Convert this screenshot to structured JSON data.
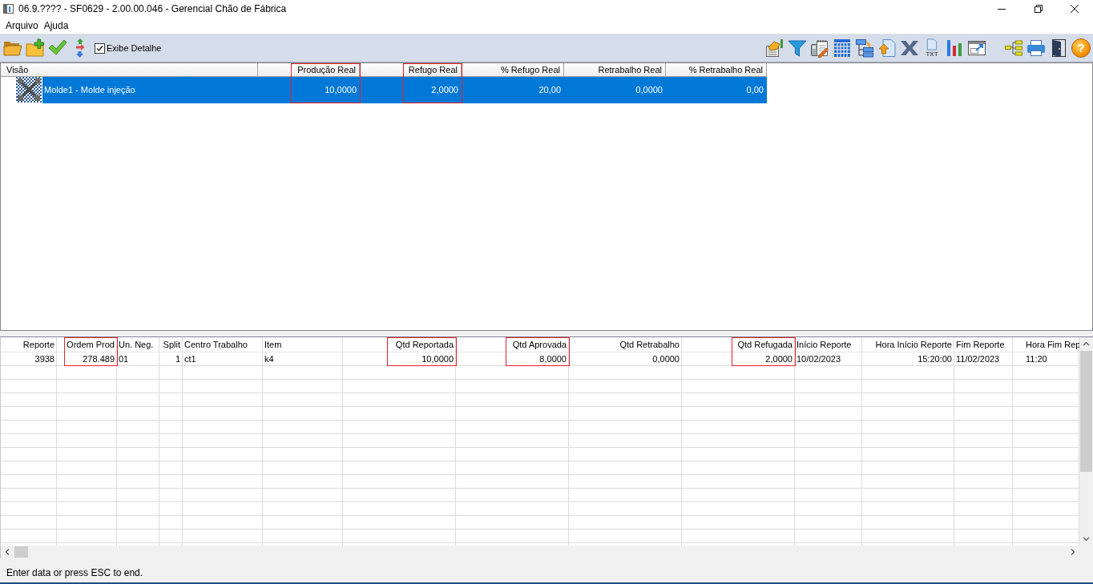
{
  "window": {
    "title": "06.9.???? - SF0629 - 2.00.00.046 - Gerencial Chão de Fábrica"
  },
  "menu": [
    {
      "label": "Arquivo"
    },
    {
      "label": "Ajuda"
    }
  ],
  "toolbar": {
    "detail_checkbox": {
      "label": "Exibe Detalhe",
      "checked": true
    },
    "txt_caption": "TXT",
    "help_glyph": "?"
  },
  "top_grid": {
    "columns": [
      {
        "label": "Visão",
        "highlighted": false
      },
      {
        "label": "Produção Real",
        "highlighted": true
      },
      {
        "label": "Refugo Real",
        "highlighted": true
      },
      {
        "label": "% Refugo Real",
        "highlighted": false
      },
      {
        "label": "Retrabalho Real",
        "highlighted": false
      },
      {
        "label": "% Retrabalho Real",
        "highlighted": false
      }
    ],
    "rows": [
      {
        "selected": true,
        "cells": [
          "Molde1 - Molde injeção",
          "10,0000",
          "2,0000",
          "20,00",
          "0,0000",
          "0,00"
        ]
      }
    ]
  },
  "bottom_grid": {
    "columns": [
      {
        "label": "Reporte",
        "highlighted": false
      },
      {
        "label": "Ordem Prod",
        "highlighted": true
      },
      {
        "label": "Un. Neg.",
        "highlighted": false
      },
      {
        "label": "Split",
        "highlighted": false
      },
      {
        "label": "Centro Trabalho",
        "highlighted": false
      },
      {
        "label": "Item",
        "highlighted": false
      },
      {
        "label": "Qtd Reportada",
        "highlighted": true
      },
      {
        "label": "Qtd Aprovada",
        "highlighted": true
      },
      {
        "label": "Qtd Retrabalho",
        "highlighted": false
      },
      {
        "label": "Qtd Refugada",
        "highlighted": true
      },
      {
        "label": "Início Reporte",
        "highlighted": false
      },
      {
        "label": "Hora Início Reporte",
        "highlighted": false
      },
      {
        "label": "Fim Reporte",
        "highlighted": false
      },
      {
        "label": "Hora Fim Rep",
        "highlighted": false
      }
    ],
    "rows": [
      {
        "cells": [
          "3938",
          "278.489",
          "01",
          "1",
          "ct1",
          "k4",
          "10,0000",
          "8,0000",
          "0,0000",
          "2,0000",
          "10/02/2023",
          "15:20:00",
          "11/02/2023",
          "11:20"
        ]
      }
    ]
  },
  "status_bar": {
    "text": "Enter data or press ESC to end."
  }
}
